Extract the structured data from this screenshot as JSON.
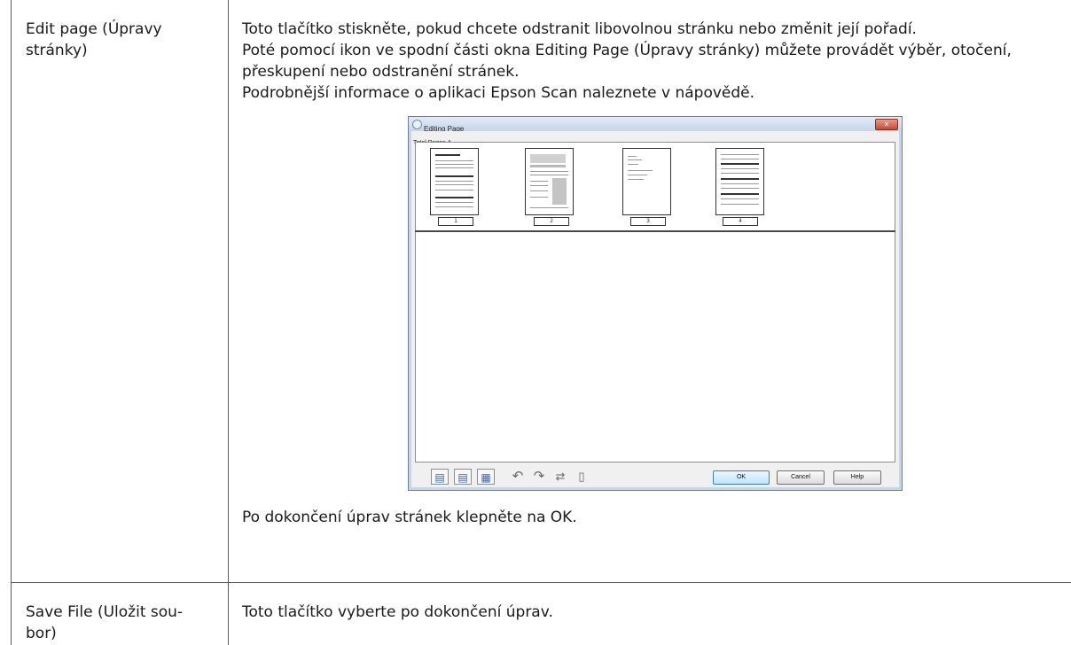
{
  "rows": [
    {
      "term": "Edit page (Úpravy stránky)",
      "paragraphs": [
        "Toto tlačítko stiskněte, pokud chcete odstranit libovolnou stránku nebo změnit její pořadí.",
        "Poté pomocí ikon ve spodní části okna Editing Page (Úpravy stránky) můžete provádět výběr, otočení, přeskupení nebo odstranění stránek.",
        "Podrobnější informace o aplikaci Epson Scan naleznete v nápovědě."
      ],
      "after_paragraph": "Po dokončení úprav stránek klepněte na OK."
    },
    {
      "term": "Save File (Uložit sou-bor)",
      "paragraphs": [
        "Toto tlačítko vyberte po dokončení úprav."
      ]
    }
  ],
  "dialog": {
    "title": "Editing Page",
    "total_pages": "Total Pages 4",
    "page_numbers": [
      "1",
      "2",
      "3",
      "4"
    ],
    "buttons": {
      "ok": "OK",
      "cancel": "Cancel",
      "help": "Help"
    },
    "toolbar_icons": [
      "select-odd-pages-icon",
      "select-even-pages-icon",
      "select-all-pages-icon",
      "rotate-left-icon",
      "rotate-right-icon",
      "reorder-icon",
      "delete-icon"
    ],
    "colors": {
      "title_bar": "#c4d6ea",
      "close_button": "#c54a34"
    }
  }
}
